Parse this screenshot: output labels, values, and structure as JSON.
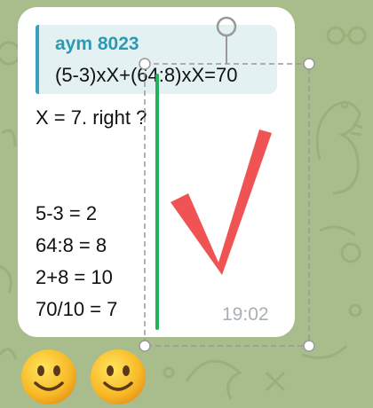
{
  "colors": {
    "wallpaper": "#a9bd8c",
    "bubble": "#ffffff",
    "reply_accent": "#3aa0c0",
    "reply_author": "#2b9ab5",
    "checkmark": "#f05353",
    "pen_line": "#1fb35c",
    "selection": "#999999",
    "timestamp": "#a8b0b4"
  },
  "reply": {
    "author": "aym 8023",
    "text": "(5-3)xX+(64:8)xX=70"
  },
  "message": {
    "line1": "X = 7. right ?",
    "calc": [
      "5-3 = 2",
      "64:8 = 8",
      "2+8 = 10",
      "70/10 = 7"
    ],
    "time": "19:02"
  },
  "drawing": {
    "checkmark_icon": "checkmark-icon",
    "pen_line_icon": "green-line-icon"
  },
  "reactions": [
    {
      "icon": "smiling-face-emoji"
    },
    {
      "icon": "smiling-face-emoji"
    }
  ]
}
